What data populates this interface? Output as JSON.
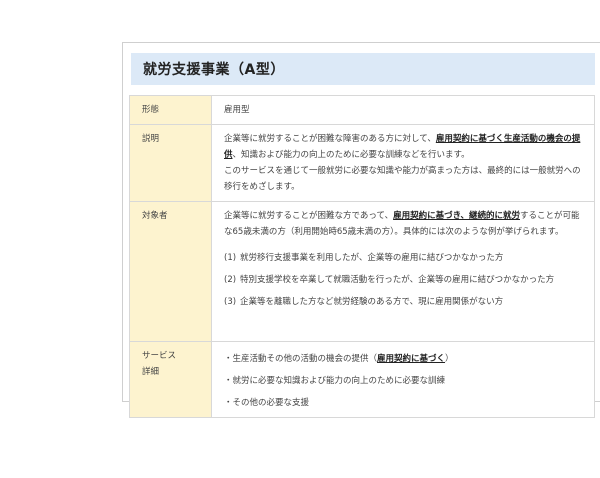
{
  "title": "就労支援事業（A型）",
  "rows": {
    "form": {
      "label": "形態",
      "value": "雇用型"
    },
    "description": {
      "label": "説明",
      "line1_pre": "企業等に就労することが困難な障害のある方に対して、",
      "line1_em": "雇用契約に基づく生産活動の機会の提供",
      "line1_post": "、知識および能力の向上のために必要な訓練などを行います。",
      "line2": "このサービスを通じて一般就労に必要な知識や能力が高まった方は、最終的には一般就労への移行をめざします。"
    },
    "target": {
      "label": "対象者",
      "intro_pre": "企業等に就労することが困難な方であって、",
      "intro_em": "雇用契約に基づき、継続的に就労",
      "intro_post": "することが可能な65歳未満の方（利用開始時65歳未満の方）。具体的には次のような例が挙げられます。",
      "items": [
        {
          "num": "(1)",
          "text": "就労移行支援事業を利用したが、企業等の雇用に結びつかなかった方"
        },
        {
          "num": "(2)",
          "text": "特別支援学校を卒業して就職活動を行ったが、企業等の雇用に結びつかなかった方"
        },
        {
          "num": "(3)",
          "text": "企業等を離職した方など就労経験のある方で、現に雇用関係がない方"
        }
      ]
    },
    "service": {
      "label_line1": "サービス",
      "label_line2": "詳細",
      "item1_pre": "・生産活動その他の活動の機会の提供（",
      "item1_em": "雇用契約に基づく",
      "item1_post": "）",
      "item2": "・就労に必要な知識および能力の向上のために必要な訓練",
      "item3": "・その他の必要な支援"
    }
  },
  "colors": {
    "title_bg": "#dce9f7",
    "label_bg": "#fdf3cf",
    "border": "#d8d8d8"
  }
}
